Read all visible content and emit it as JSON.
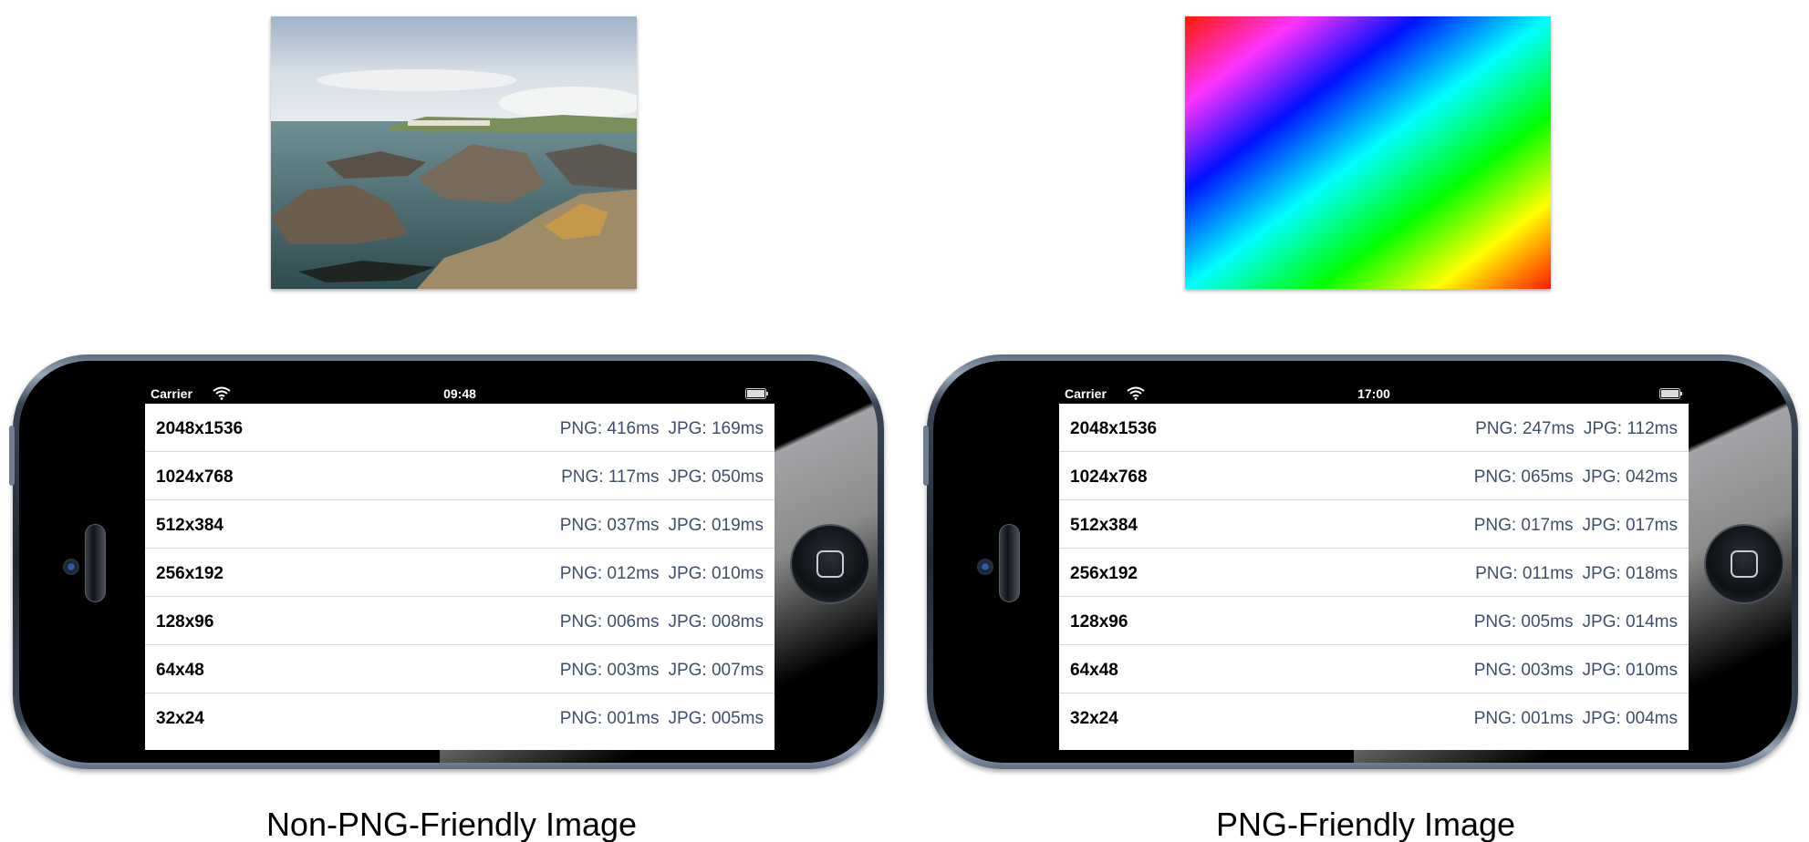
{
  "panels": [
    {
      "id": "non-png-friendly",
      "caption": "Non-PNG-Friendly Image",
      "sample_image": "photo-seaside-rocks",
      "status": {
        "carrier": "Carrier",
        "time": "09:48"
      },
      "rows": [
        {
          "resolution": "2048x1536",
          "png": "PNG: 416ms",
          "jpg": "JPG: 169ms"
        },
        {
          "resolution": "1024x768",
          "png": "PNG: 117ms",
          "jpg": "JPG: 050ms"
        },
        {
          "resolution": "512x384",
          "png": "PNG: 037ms",
          "jpg": "JPG: 019ms"
        },
        {
          "resolution": "256x192",
          "png": "PNG: 012ms",
          "jpg": "JPG: 010ms"
        },
        {
          "resolution": "128x96",
          "png": "PNG: 006ms",
          "jpg": "JPG: 008ms"
        },
        {
          "resolution": "64x48",
          "png": "PNG: 003ms",
          "jpg": "JPG: 007ms"
        },
        {
          "resolution": "32x24",
          "png": "PNG: 001ms",
          "jpg": "JPG: 005ms"
        }
      ]
    },
    {
      "id": "png-friendly",
      "caption": "PNG-Friendly Image",
      "sample_image": "rainbow-gradient",
      "status": {
        "carrier": "Carrier",
        "time": "17:00"
      },
      "rows": [
        {
          "resolution": "2048x1536",
          "png": "PNG: 247ms",
          "jpg": "JPG: 112ms"
        },
        {
          "resolution": "1024x768",
          "png": "PNG: 065ms",
          "jpg": "JPG: 042ms"
        },
        {
          "resolution": "512x384",
          "png": "PNG: 017ms",
          "jpg": "JPG: 017ms"
        },
        {
          "resolution": "256x192",
          "png": "PNG: 011ms",
          "jpg": "JPG: 018ms"
        },
        {
          "resolution": "128x96",
          "png": "PNG: 005ms",
          "jpg": "JPG: 014ms"
        },
        {
          "resolution": "64x48",
          "png": "PNG: 003ms",
          "jpg": "JPG: 010ms"
        },
        {
          "resolution": "32x24",
          "png": "PNG: 001ms",
          "jpg": "JPG: 004ms"
        }
      ]
    }
  ],
  "colors": {
    "timing_text": "#3e4f6b",
    "status_bar": "#000000",
    "row_divider": "#d9d9d9"
  }
}
